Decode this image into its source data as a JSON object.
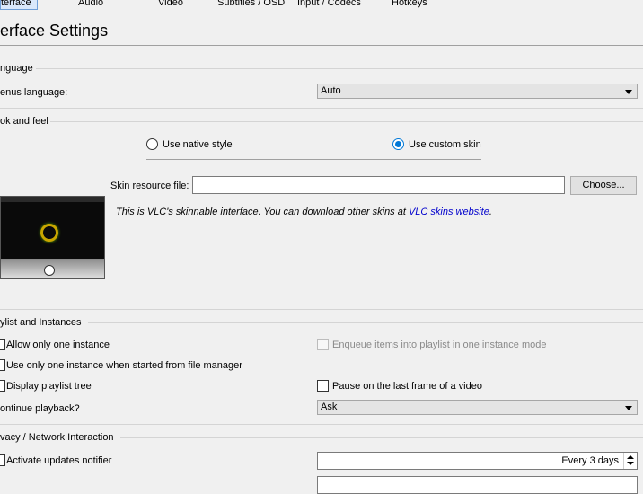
{
  "tabs": [
    {
      "label": "terface",
      "active": true
    },
    {
      "label": "Audio"
    },
    {
      "label": "Video"
    },
    {
      "label": "Subtitles / OSD"
    },
    {
      "label": "Input / Codecs"
    },
    {
      "label": "Hotkeys"
    }
  ],
  "title": "erface Settings",
  "language": {
    "group_label": "nguage",
    "menus_label": "enus language:",
    "menus_value": "Auto"
  },
  "look_and_feel": {
    "group_label": "ok and feel",
    "native_style_label": "Use native style",
    "custom_skin_label": "Use custom skin",
    "selected": "custom_skin",
    "skin_file_label": "Skin resource file:",
    "skin_file_value": "",
    "choose_button": "Choose...",
    "info_text": "This is VLC's skinnable interface. You can download other skins at ",
    "info_link": "VLC skins website",
    "info_suffix": "."
  },
  "playlist": {
    "group_label": "ylist and Instances",
    "allow_one_instance": "Allow only one instance",
    "enqueue_items": "Enqueue items into playlist in one instance mode",
    "one_instance_file_manager": "Use only one instance when started from file manager",
    "display_tree": "Display playlist tree",
    "pause_last_frame": "Pause on the last frame of a video",
    "continue_label": "ontinue playback?",
    "continue_value": "Ask"
  },
  "privacy": {
    "group_label": "vacy / Network Interaction",
    "updates_notifier": "Activate updates notifier",
    "updates_interval": "Every 3 days"
  },
  "colors": {
    "accent": "#0078d7",
    "link": "#0000cc"
  }
}
